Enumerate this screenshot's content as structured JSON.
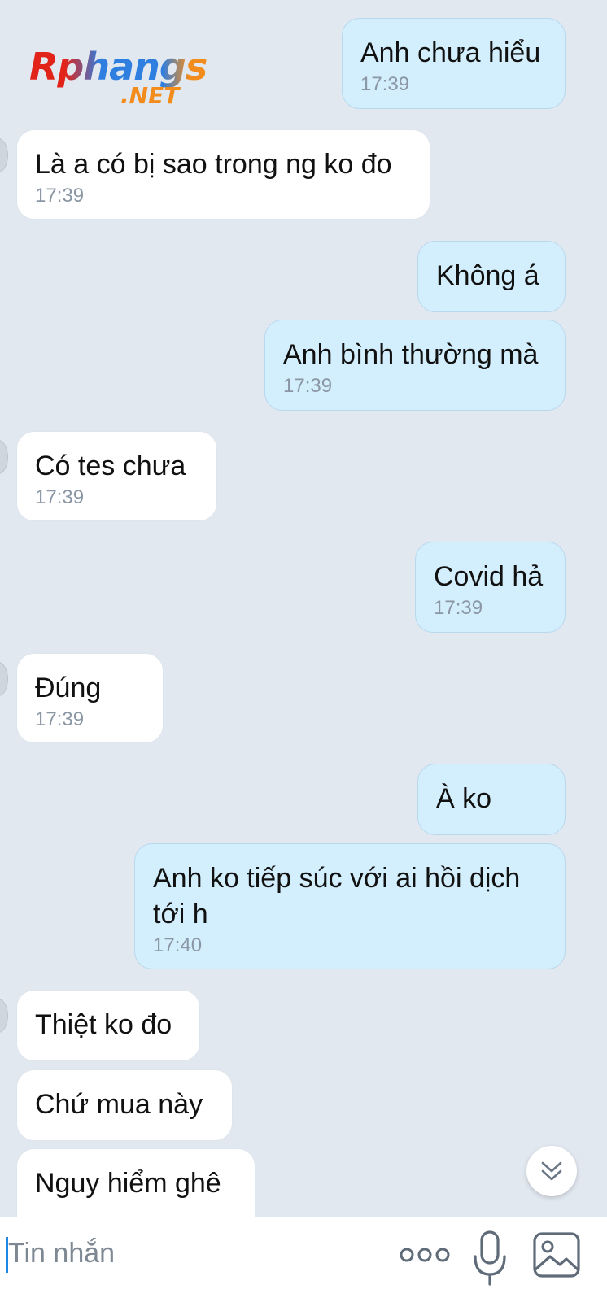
{
  "watermark": {
    "brand": "Rphangs",
    "suffix": ".NET"
  },
  "messages": [
    {
      "side": "out",
      "text": "Anh chưa hiểu",
      "time": "17:39"
    },
    {
      "side": "in",
      "text": "Là a có bị sao trong ng ko đo",
      "time": "17:39"
    },
    {
      "side": "out",
      "text": "Không á",
      "time": ""
    },
    {
      "side": "out",
      "text": "Anh bình thường mà",
      "time": "17:39"
    },
    {
      "side": "in",
      "text": "Có tes chưa",
      "time": "17:39"
    },
    {
      "side": "out",
      "text": "Covid hả",
      "time": "17:39"
    },
    {
      "side": "in",
      "text": "Đúng",
      "time": "17:39"
    },
    {
      "side": "out",
      "text": "À ko",
      "time": ""
    },
    {
      "side": "out",
      "text": "Anh ko tiếp súc với ai hồi dịch\ntới h",
      "time": "17:40"
    },
    {
      "side": "in",
      "text": "Thiệt ko đo",
      "time": ""
    },
    {
      "side": "in",
      "text": "Chứ mua này",
      "time": ""
    },
    {
      "side": "in",
      "text": "Nguy hiểm ghê",
      "time": ""
    }
  ],
  "composer": {
    "placeholder": "Tin nhắn",
    "more_icon": "more-dots-icon",
    "mic_icon": "microphone-icon",
    "image_icon": "image-gallery-icon"
  },
  "scroll_button_icon": "chevron-double-down-icon",
  "colors": {
    "background": "#e2e8f0",
    "outgoing_bubble": "#d3eefc",
    "incoming_bubble": "#ffffff",
    "timestamp": "#8a96a3",
    "caret": "#1e88e5"
  }
}
